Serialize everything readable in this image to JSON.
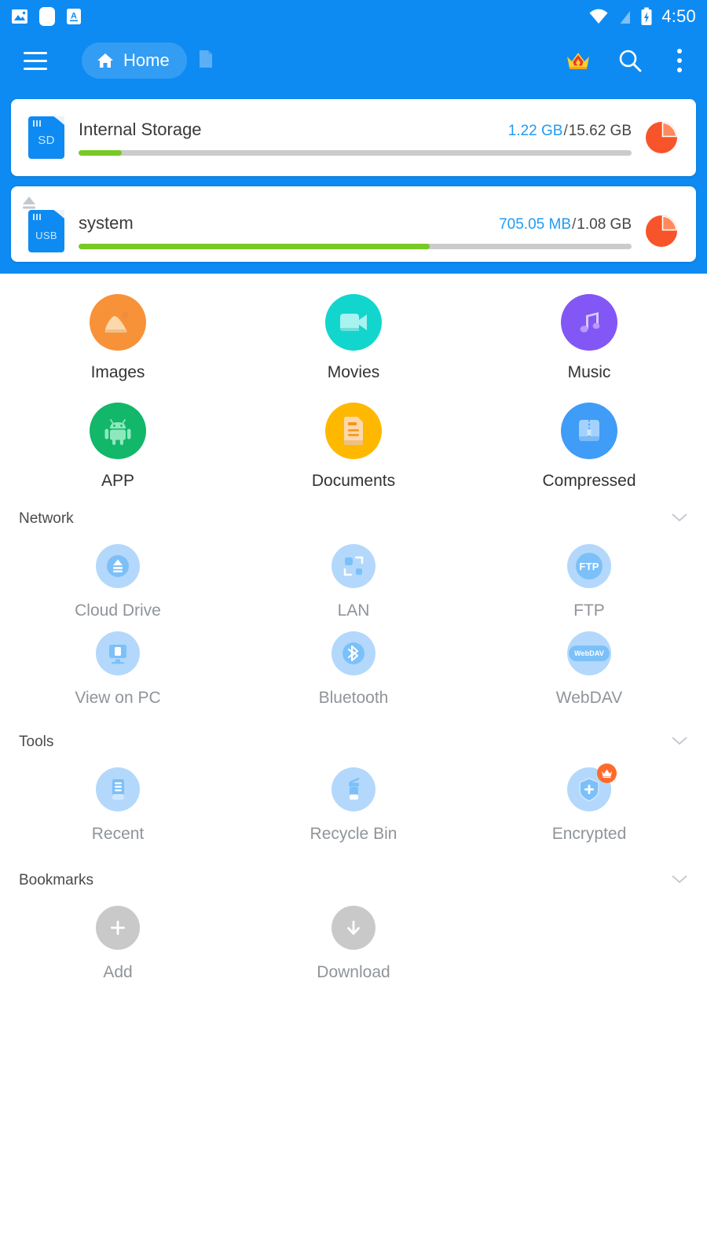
{
  "status_bar": {
    "notification_icons": [
      "image-notification-icon",
      "rounded-square-notification-icon",
      "letter-a-notification-icon"
    ],
    "wifi_icon": "wifi-icon",
    "signal_icon": "signal-off-icon",
    "battery_icon": "battery-charging-icon",
    "time": "4:50"
  },
  "toolbar": {
    "menu_icon": "hamburger-menu-icon",
    "breadcrumb_home": "Home",
    "breadcrumb_doc_icon": "document-icon",
    "premium_icon": "crown-icon",
    "search_icon": "search-icon",
    "overflow_icon": "more-vertical-icon"
  },
  "storage": [
    {
      "icon_text": "SD",
      "icon_name": "sd-card-icon",
      "title": "Internal Storage",
      "used": "1.22 GB",
      "separator": "/",
      "total": "15.62 GB",
      "percent": 7.8,
      "has_eject": false,
      "chart_icon": "pie-chart-icon"
    },
    {
      "icon_text": "USB",
      "icon_name": "usb-storage-icon",
      "title": "system",
      "used": "705.05 MB",
      "separator": "/",
      "total": "1.08 GB",
      "percent": 63.5,
      "has_eject": true,
      "eject_icon": "eject-icon",
      "chart_icon": "pie-chart-icon"
    }
  ],
  "categories": [
    {
      "label": "Images",
      "icon": "image-icon",
      "color": "#f79239"
    },
    {
      "label": "Movies",
      "icon": "video-icon",
      "color": "#12d6ce"
    },
    {
      "label": "Music",
      "icon": "music-note-icon",
      "color": "#8257f5"
    },
    {
      "label": "APP",
      "icon": "android-icon",
      "color": "#12b76a"
    },
    {
      "label": "Documents",
      "icon": "document-icon",
      "color": "#ffb800"
    },
    {
      "label": "Compressed",
      "icon": "archive-zip-icon",
      "color": "#3f9cf7"
    }
  ],
  "sections": [
    {
      "title": "Network",
      "collapse_icon": "chevron-down-icon",
      "items": [
        {
          "label": "Cloud Drive",
          "icon": "cloud-drive-icon"
        },
        {
          "label": "LAN",
          "icon": "lan-icon"
        },
        {
          "label": "FTP",
          "icon": "ftp-icon",
          "icon_text": "FTP"
        },
        {
          "label": "View on PC",
          "icon": "view-on-pc-icon"
        },
        {
          "label": "Bluetooth",
          "icon": "bluetooth-icon"
        },
        {
          "label": "WebDAV",
          "icon": "webdav-icon",
          "icon_text": "WebDAV"
        }
      ]
    },
    {
      "title": "Tools",
      "collapse_icon": "chevron-down-icon",
      "items": [
        {
          "label": "Recent",
          "icon": "recent-icon"
        },
        {
          "label": "Recycle Bin",
          "icon": "recycle-bin-icon"
        },
        {
          "label": "Encrypted",
          "icon": "encrypted-shield-icon",
          "badge": "crown-badge-icon"
        }
      ]
    },
    {
      "title": "Bookmarks",
      "collapse_icon": "chevron-down-icon",
      "items": [
        {
          "label": "Add",
          "icon": "plus-icon"
        },
        {
          "label": "Download",
          "icon": "download-arrow-icon"
        }
      ]
    }
  ],
  "colors": {
    "header_blue": "#0d8bf2",
    "accent_blue": "#1f9bf5",
    "progress_green": "#77c925",
    "progress_track": "#cbcbcb",
    "pie_orange": "#f8542a",
    "network_icon_bg": "#b3d8fb",
    "bookmark_icon_bg": "#c9c9c9"
  }
}
